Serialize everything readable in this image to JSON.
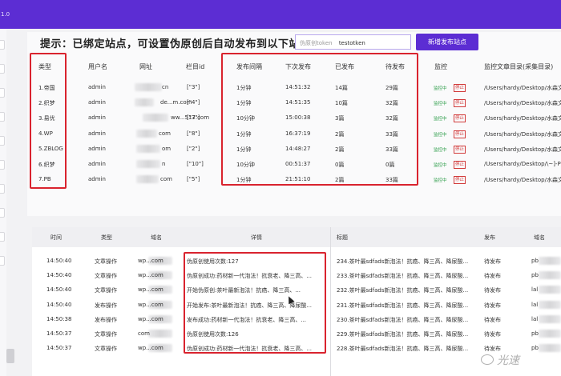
{
  "app": {
    "version": "1.0"
  },
  "notice": "提示：已绑定站点，可设置伪原创后自动发布到以下站点",
  "token": {
    "placeholder": "伪原创token",
    "value": "testotken"
  },
  "add_button": "新增发布站点",
  "sites": {
    "headers": [
      "类型",
      "用户名",
      "网址",
      "栏目id",
      "发布间隔",
      "下次发布",
      "已发布",
      "待发布",
      "监控",
      "监控文章目录(采集目录)"
    ],
    "monitor_label": "监控中",
    "stop_label": "停止",
    "rows": [
      {
        "type": "1.帝国",
        "user": "admin",
        "url": "cn",
        "col": "[\"3\"]",
        "interval": "1分钟",
        "next": "14:51:32",
        "published": "14篇",
        "pending": "29篇",
        "dir": "/Users/hardy/Desktop/水森文"
      },
      {
        "type": "2.织梦",
        "user": "admin",
        "url": "de...m.com",
        "col": "[\"4\"]",
        "interval": "1分钟",
        "next": "14:51:35",
        "published": "10篇",
        "pending": "32篇",
        "dir": "/Users/hardy/Desktop/水森文"
      },
      {
        "type": "3.易优",
        "user": "admin",
        "url": "ww...517.com",
        "col": "[\"3\"]",
        "interval": "10分钟",
        "next": "15:00:38",
        "published": "3篇",
        "pending": "32篇",
        "dir": "/Users/hardy/Desktop/水森文"
      },
      {
        "type": "4.WP",
        "user": "admin",
        "url": "com",
        "col": "[\"8\"]",
        "interval": "1分钟",
        "next": "16:37:19",
        "published": "2篇",
        "pending": "33篇",
        "dir": "/Users/hardy/Desktop/水森文"
      },
      {
        "type": "5.ZBLOG",
        "user": "admin",
        "url": "om",
        "col": "[\"2\"]",
        "interval": "1分钟",
        "next": "14:48:27",
        "published": "2篇",
        "pending": "33篇",
        "dir": "/Users/hardy/Desktop/水森文"
      },
      {
        "type": "6.织梦",
        "user": "admin",
        "url": "n",
        "col": "[\"10\"]",
        "interval": "10分钟",
        "next": "00:51:37",
        "published": "0篇",
        "pending": "0篇",
        "dir": "/Users/hardy/Desktop/\\~]-PC"
      },
      {
        "type": "7.PB",
        "user": "admin",
        "url": "com",
        "col": "[\"5\"]",
        "interval": "1分钟",
        "next": "21:51:10",
        "published": "2篇",
        "pending": "33篇",
        "dir": "/Users/hardy/Desktop/水森文"
      }
    ]
  },
  "logs": {
    "headers": [
      "时间",
      "类型",
      "域名",
      "详情",
      "标题",
      "发布",
      "域名"
    ],
    "rows": [
      {
        "time": "14:50:40",
        "type": "文章操作",
        "domain": "wp...com",
        "detail": "伪原创使用次数:127",
        "title": "234.茶叶最sdfads新泡法！抗癌、降三高、降尿酸...",
        "status": "待发布",
        "domain2": "pb"
      },
      {
        "time": "14:50:40",
        "type": "文章操作",
        "domain": "wp...com",
        "detail": "伪原创成功:药材新一代泡法！抗衰老、降三高、...",
        "title": "233.茶叶最sdfads新泡法！抗癌、降三高、降尿酸...",
        "status": "待发布",
        "domain2": "pb"
      },
      {
        "time": "14:50:40",
        "type": "文章操作",
        "domain": "wp...com",
        "detail": "开始伪原创:茶叶最新泡法！抗癌、降三高、...",
        "title": "232.茶叶最sdfads新泡法！抗癌、降三高、降尿酸...",
        "status": "待发布",
        "domain2": "lal"
      },
      {
        "time": "14:50:40",
        "type": "发布操作",
        "domain": "wp...com",
        "detail": "开始发布:茶叶最新泡法！抗癌、降三高、降尿酸...",
        "title": "231.茶叶最sdfads新泡法！抗癌、降三高、降尿酸...",
        "status": "待发布",
        "domain2": "lal"
      },
      {
        "time": "14:50:38",
        "type": "发布操作",
        "domain": "wp...com",
        "detail": "发布成功:药材新一代泡法！抗衰老、降三高、...",
        "title": "230.茶叶最sdfads新泡法！抗癌、降三高、降尿酸...",
        "status": "待发布",
        "domain2": "lal"
      },
      {
        "time": "14:50:37",
        "type": "文章操作",
        "domain": "com",
        "detail": "伪原创使用次数:126",
        "title": "229.茶叶最sdfads新泡法！抗癌、降三高、降尿酸...",
        "status": "待发布",
        "domain2": "pb"
      },
      {
        "time": "14:50:37",
        "type": "文章操作",
        "domain": "wp...com",
        "detail": "伪原创成功:药材新一代泡法！抗衰老、降三高、...",
        "title": "228.茶叶最sdfads新泡法！抗癌、降三高、降尿酸...",
        "status": "待发布",
        "domain2": "pb"
      }
    ]
  },
  "watermark": "光速"
}
